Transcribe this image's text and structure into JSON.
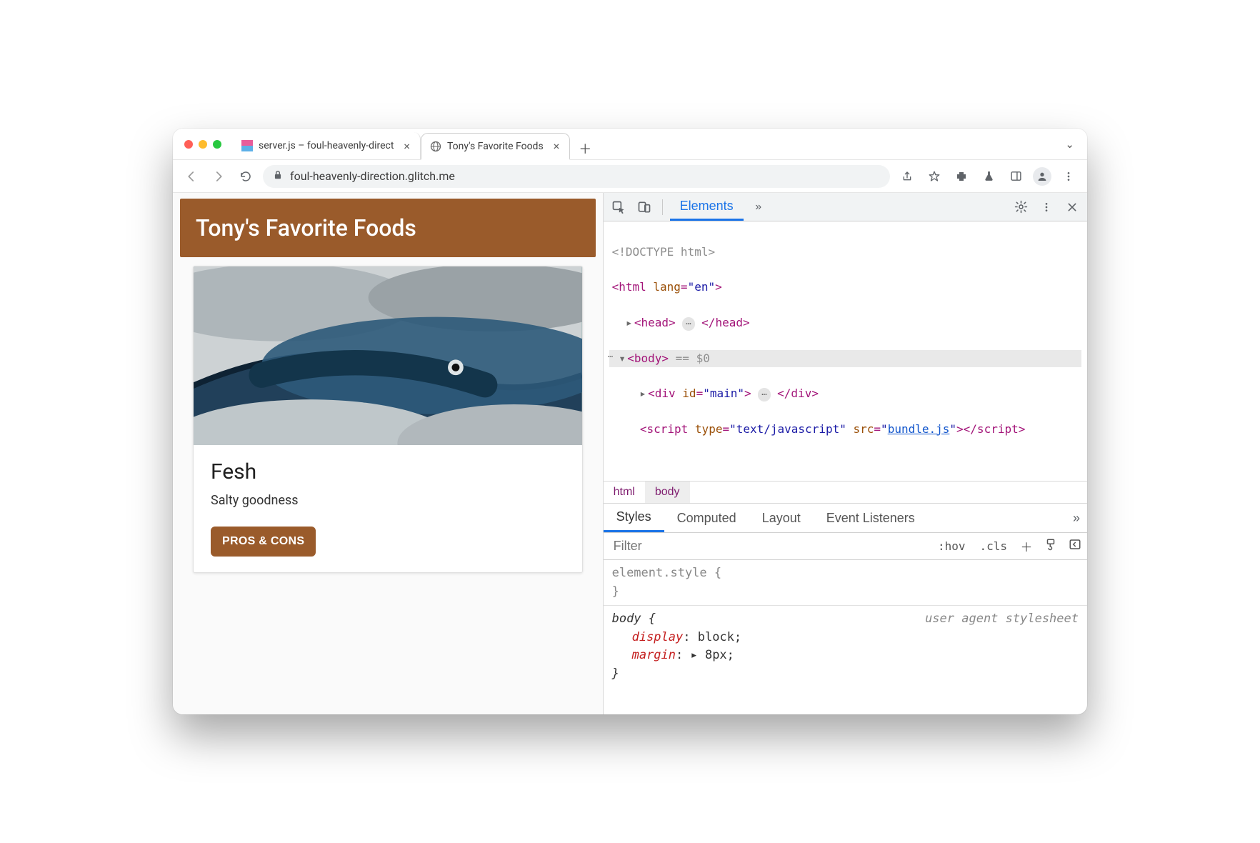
{
  "browser": {
    "tabs": [
      {
        "title": "server.js – foul-heavenly-direct",
        "active": false
      },
      {
        "title": "Tony's Favorite Foods",
        "active": true
      }
    ],
    "url": "foul-heavenly-direction.glitch.me"
  },
  "page": {
    "header": "Tony's Favorite Foods",
    "card": {
      "title": "Fesh",
      "subtitle": "Salty goodness",
      "button": "PROS & CONS"
    }
  },
  "devtools": {
    "main_tabs": {
      "active": "Elements"
    },
    "dom": {
      "doctype": "<!DOCTYPE html>",
      "html_attr_name": "lang",
      "html_attr_val": "\"en\"",
      "selected_info": "== $0",
      "div_attr_name": "id",
      "div_attr_val": "\"main\"",
      "script_type_name": "type",
      "script_type_val": "\"text/javascript\"",
      "script_src_name": "src",
      "script_src_val": "bundle.js"
    },
    "breadcrumbs": [
      "html",
      "body"
    ],
    "styles_tabs": [
      "Styles",
      "Computed",
      "Layout",
      "Event Listeners"
    ],
    "filter_placeholder": "Filter",
    "filter_chips": {
      "hov": ":hov",
      "cls": ".cls"
    },
    "rules": {
      "element_style_sel": "element.style {",
      "element_style_close": "}",
      "body_sel": "body {",
      "uas": "user agent stylesheet",
      "display_prop": "display",
      "display_val": ": block;",
      "margin_prop": "margin",
      "margin_val": ": ▸ 8px;",
      "body_close": "}"
    }
  }
}
